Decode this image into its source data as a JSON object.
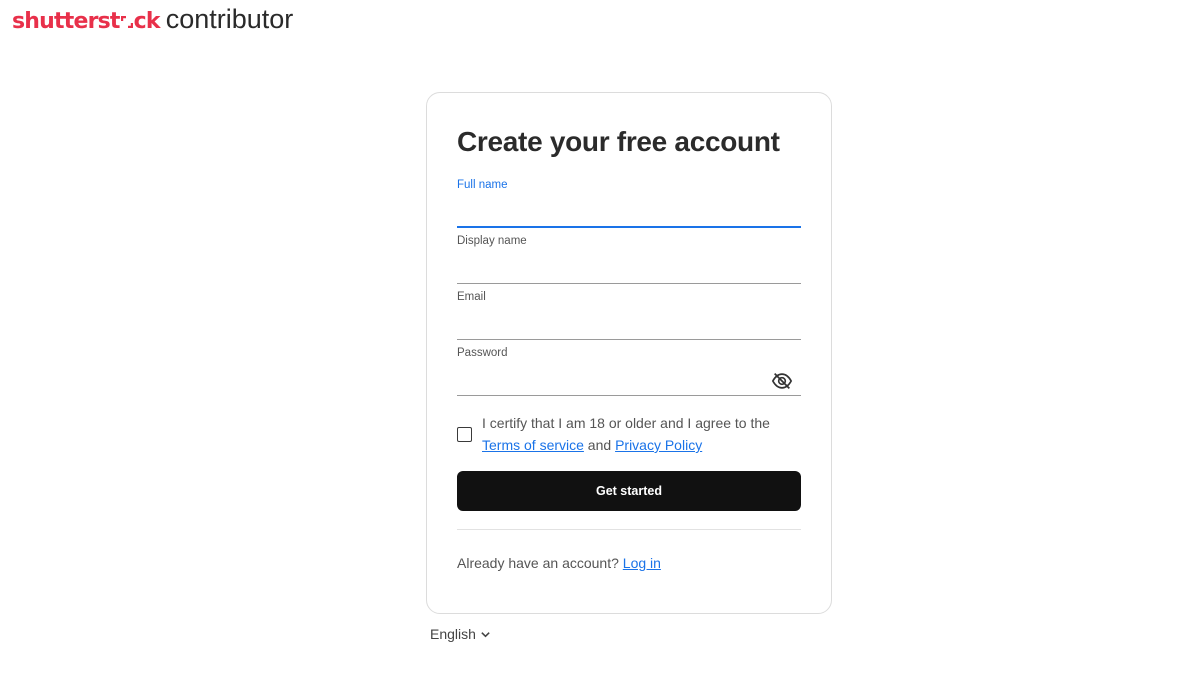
{
  "brand": {
    "name_part1": "shutterst",
    "name_part2": "ck",
    "product": "contributor",
    "brand_color": "#e8304a"
  },
  "form": {
    "title": "Create your free account",
    "fields": {
      "full_name": {
        "label": "Full name",
        "value": "",
        "placeholder": ""
      },
      "display_name": {
        "label": "Display name",
        "value": "",
        "placeholder": ""
      },
      "email": {
        "label": "Email",
        "value": "",
        "placeholder": ""
      },
      "password": {
        "label": "Password",
        "value": "",
        "placeholder": ""
      }
    },
    "password_toggle_icon": "eye-off-icon",
    "consent": {
      "text_before": "I certify that I am 18 or older and I agree to the ",
      "terms_link": "Terms of service",
      "text_between": " and ",
      "privacy_link": "Privacy Policy",
      "checked": false
    },
    "submit_label": "Get started",
    "login_prompt": "Already have an account? ",
    "login_link": "Log in"
  },
  "language": {
    "selected": "English",
    "icon": "chevron-down-icon"
  },
  "colors": {
    "accent": "#1a73e8",
    "button_bg": "#111111"
  }
}
